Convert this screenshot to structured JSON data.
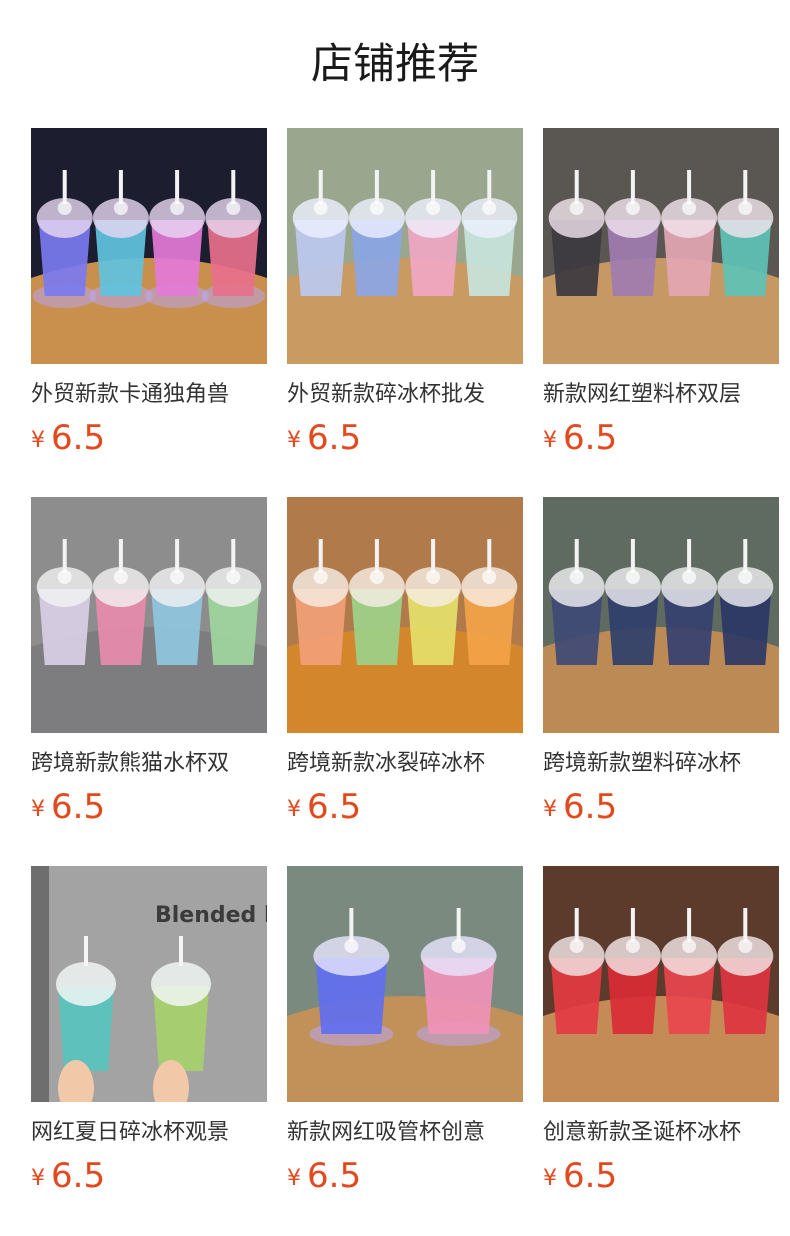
{
  "section": {
    "title": "店铺推荐"
  },
  "products": [
    {
      "name": "外贸新款卡通独角兽",
      "currency": "¥",
      "price": "6.5",
      "scene": {
        "bg": "#1c1d2e",
        "table": "#c98f4c",
        "cups": [
          "#7a7bf0",
          "#5fc3e0",
          "#e47ad8",
          "#e7708c"
        ],
        "top": "#e9d8f2",
        "glow": true
      }
    },
    {
      "name": "外贸新款碎冰杯批发",
      "currency": "¥",
      "price": "6.5",
      "scene": {
        "bg": "#9aa68e",
        "table": "#c99a62",
        "cups": [
          "#bcc9f0",
          "#8aa6e6",
          "#f0a7c3",
          "#c8e4dc"
        ],
        "top": "#eef0ff",
        "glow": false
      }
    },
    {
      "name": "新款网红塑料杯双层",
      "currency": "¥",
      "price": "6.5",
      "scene": {
        "bg": "#5a5753",
        "table": "#c59864",
        "cups": [
          "#3c3840",
          "#a07cb0",
          "#e3a6b3",
          "#5ec2b6"
        ],
        "top": "#f3e6ef",
        "glow": false
      }
    },
    {
      "name": "跨境新款熊猫水杯双",
      "currency": "¥",
      "price": "6.5",
      "scene": {
        "bg": "#8e8d8e",
        "table": "#7d7c7e",
        "cups": [
          "#d9cfe6",
          "#e78bab",
          "#8fc7de",
          "#9fd69f"
        ],
        "top": "#f2f2f2",
        "glow": false
      }
    },
    {
      "name": "跨境新款冰裂碎冰杯",
      "currency": "¥",
      "price": "6.5",
      "scene": {
        "bg": "#b17a4b",
        "table": "#d4862d",
        "cups": [
          "#f2a077",
          "#9dd18a",
          "#e4e06a",
          "#f3a349"
        ],
        "top": "#f7efe6",
        "glow": false
      }
    },
    {
      "name": "跨境新款塑料碎冰杯",
      "currency": "¥",
      "price": "6.5",
      "scene": {
        "bg": "#5f6a61",
        "table": "#bc8a54",
        "cups": [
          "#3e4a76",
          "#2f3f6c",
          "#354070",
          "#2c3766"
        ],
        "top": "#f1f1f4",
        "glow": false
      }
    },
    {
      "name": "网红夏日碎冰杯观景",
      "currency": "¥",
      "price": "6.5",
      "scene": {
        "bg": "#9c9c9c",
        "table": "#b7b7b7",
        "cups": [
          "#57c4be",
          "#a7d26b"
        ],
        "top": "#f0f6f4",
        "glow": false,
        "hands": true,
        "wall": "Blended by"
      }
    },
    {
      "name": "新款网红吸管杯创意",
      "currency": "¥",
      "price": "6.5",
      "scene": {
        "bg": "#7a8a7e",
        "table": "#c2915a",
        "cups": [
          "#5f6ff0",
          "#f092b8"
        ],
        "top": "#e9e6ff",
        "glow": true
      }
    },
    {
      "name": "创意新款圣诞杯冰杯",
      "currency": "¥",
      "price": "6.5",
      "scene": {
        "bg": "#5c3b2d",
        "table": "#c48b57",
        "cups": [
          "#e33b42",
          "#d92b35",
          "#e8464d",
          "#dd3440"
        ],
        "top": "#f5eaea",
        "glow": false
      }
    }
  ]
}
